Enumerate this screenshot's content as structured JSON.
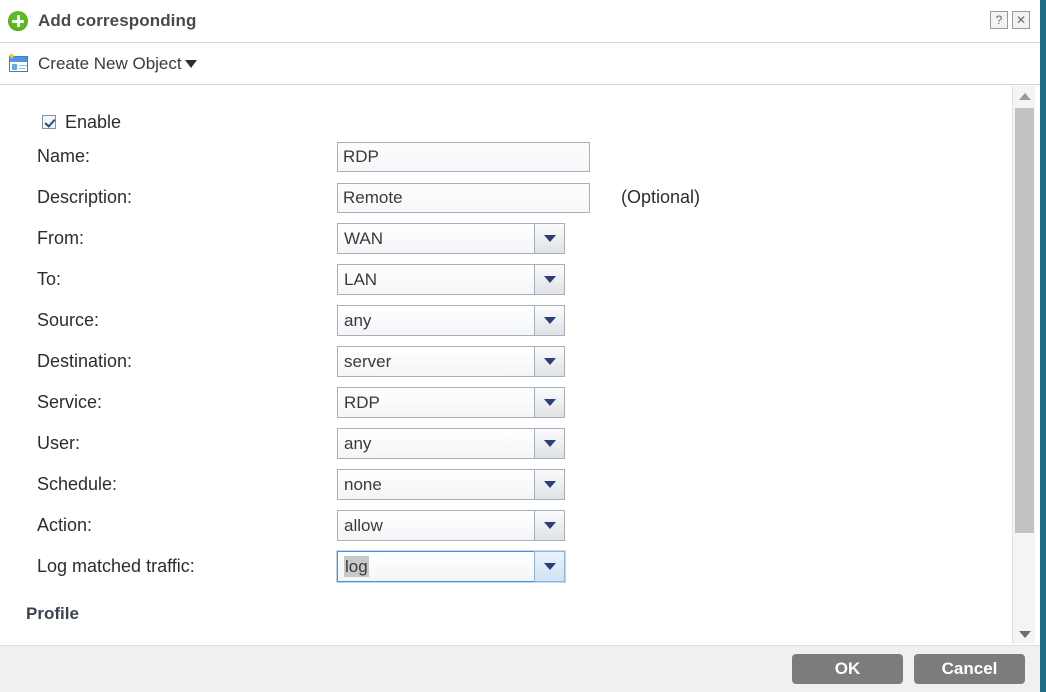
{
  "window": {
    "title": "Add corresponding",
    "add_icon": "plus-circle-icon",
    "help_label": "?",
    "close_label": "✕"
  },
  "toolbar": {
    "create_object_label": "Create New Object",
    "create_object_icon": "new-object-card-icon",
    "caret_icon": "caret-down-icon"
  },
  "form": {
    "enable": {
      "label": "Enable",
      "checked": true
    },
    "optional_note": "(Optional)",
    "fields": [
      {
        "label": "Name:",
        "value": "RDP",
        "type": "text"
      },
      {
        "label": "Description:",
        "value": "Remote",
        "type": "text",
        "note": "(Optional)"
      },
      {
        "label": "From:",
        "value": "WAN",
        "type": "select"
      },
      {
        "label": "To:",
        "value": "LAN",
        "type": "select"
      },
      {
        "label": "Source:",
        "value": "any",
        "type": "select"
      },
      {
        "label": "Destination:",
        "value": "server",
        "type": "select"
      },
      {
        "label": "Service:",
        "value": "RDP",
        "type": "select"
      },
      {
        "label": "User:",
        "value": "any",
        "type": "select"
      },
      {
        "label": "Schedule:",
        "value": "none",
        "type": "select"
      },
      {
        "label": "Action:",
        "value": "allow",
        "type": "select"
      },
      {
        "label": "Log matched traffic:",
        "value": "log",
        "type": "select",
        "focused": true
      }
    ],
    "section_heading": "Profile"
  },
  "scrollbar": {
    "up_icon": "scroll-up-arrow-icon",
    "down_icon": "scroll-down-arrow-icon"
  },
  "footer": {
    "ok_label": "OK",
    "cancel_label": "Cancel"
  },
  "colors": {
    "accent_teal": "#1f6d82",
    "add_green": "#5cbb20",
    "button_gray": "#7c7c7c",
    "focus_blue": "#4a90d9"
  }
}
